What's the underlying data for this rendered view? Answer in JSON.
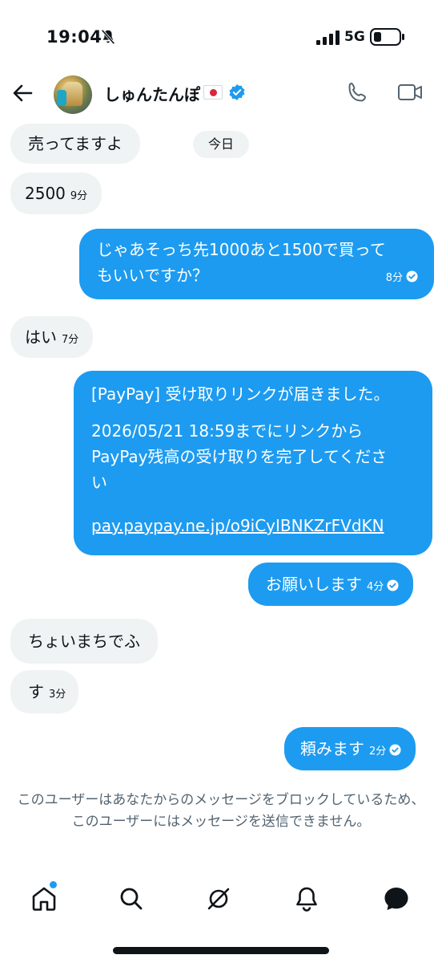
{
  "status_bar": {
    "time": "19:04",
    "network": "5G"
  },
  "header": {
    "name": "しゅんたんぽ"
  },
  "day_label": "今日",
  "messages": [
    {
      "side": "received",
      "text": "売ってますよ",
      "time": ""
    },
    {
      "side": "received",
      "text": "2500",
      "time": "9分"
    },
    {
      "side": "sent",
      "lines": [
        "じゃあそっち先1000あと1500で買って",
        "もいいですか？"
      ],
      "time": "8分"
    },
    {
      "side": "received",
      "text": "はい",
      "time": "7分"
    },
    {
      "side": "sent",
      "lines": [
        "[PayPay] 受け取りリンクが届きました。",
        "2026/05/21 18:59までにリンクから",
        "PayPay残高の受け取りを完了してくださ",
        "い",
        "pay.paypay.ne.jp/o9iCyIBNKZrFVdKN"
      ]
    },
    {
      "side": "sent",
      "text": "お願いします",
      "time": "4分"
    },
    {
      "side": "received",
      "text": "ちょいまちでふ",
      "time": ""
    },
    {
      "side": "received",
      "text": "す",
      "time": "3分"
    },
    {
      "side": "sent",
      "text": "頼みます",
      "time": "2分"
    }
  ],
  "notice": "このユーザーはあなたからのメッセージをブロックしているため、このユーザーにはメッセージを送信できません。",
  "colors": {
    "accent": "#1d9bf0",
    "received_bubble": "#eff3f4",
    "text": "#0f1419",
    "muted": "#536471"
  },
  "tab_icons": [
    "home-icon",
    "search-icon",
    "grok-icon",
    "bell-icon",
    "messages-icon"
  ]
}
